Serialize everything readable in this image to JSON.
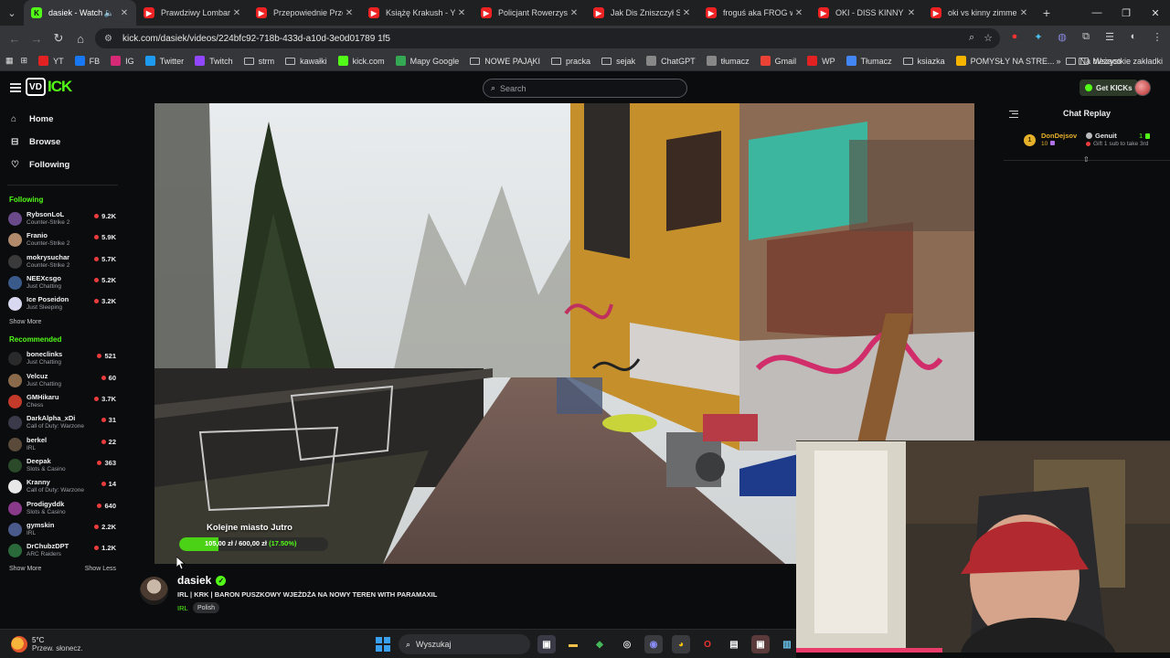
{
  "browser": {
    "tabs": [
      {
        "label": "dasiek - Watch th",
        "icon": "kick",
        "active": true,
        "audio": true
      },
      {
        "label": "Prawdziwy Lombard",
        "icon": "youtube"
      },
      {
        "label": "Przepowiednie Przes",
        "icon": "youtube"
      },
      {
        "label": "Książę Krakush - You",
        "icon": "youtube"
      },
      {
        "label": "Policjant Rowerzysta",
        "icon": "youtube"
      },
      {
        "label": "Jak Dis Zniszczył Swo",
        "icon": "youtube"
      },
      {
        "label": "froguś aka FROG wb",
        "icon": "youtube"
      },
      {
        "label": "OKI - DISS KINNY ZI",
        "icon": "youtube"
      },
      {
        "label": "oki vs kinny zimmer",
        "icon": "youtube"
      }
    ],
    "url": "kick.com/dasiek/videos/224bfc92-718b-433d-a10d-3e0d01789 1f5",
    "bookmarks": [
      {
        "label": "YT",
        "icon": "youtube",
        "color": "#e22222"
      },
      {
        "label": "FB",
        "icon": "facebook",
        "color": "#1877f2"
      },
      {
        "label": "IG",
        "icon": "instagram",
        "color": "#d62976"
      },
      {
        "label": "Twitter",
        "icon": "twitter",
        "color": "#1d9bf0"
      },
      {
        "label": "Twitch",
        "icon": "twitch",
        "color": "#9146ff"
      },
      {
        "label": "strm",
        "icon": "folder"
      },
      {
        "label": "kawałki",
        "icon": "folder"
      },
      {
        "label": "kick.com",
        "icon": "kick",
        "color": "#53fc18"
      },
      {
        "label": "Mapy Google",
        "icon": "maps",
        "color": "#34a853"
      },
      {
        "label": "NOWE PAJĄKI",
        "icon": "folder"
      },
      {
        "label": "pracka",
        "icon": "folder"
      },
      {
        "label": "sejak",
        "icon": "folder"
      },
      {
        "label": "ChatGPT",
        "icon": "chatgpt",
        "color": "#888888"
      },
      {
        "label": "tłumacz",
        "icon": "deepl",
        "color": "#888888"
      },
      {
        "label": "Gmail",
        "icon": "gmail",
        "color": "#ea4335"
      },
      {
        "label": "WP",
        "icon": "wp",
        "color": "#e22222"
      },
      {
        "label": "Tłumacz",
        "icon": "translate",
        "color": "#4285f4"
      },
      {
        "label": "ksiazka",
        "icon": "folder"
      },
      {
        "label": "POMYSŁY NA STRE...",
        "icon": "docs",
        "color": "#f4b400"
      },
      {
        "label": "Na bieżąco",
        "icon": "folder"
      }
    ],
    "bookmarks_overflow": "»",
    "bookmarks_all": "Wszystkie zakładki"
  },
  "kick": {
    "logo_badge": "VD",
    "logo_word": "ICK",
    "search_placeholder": "Search",
    "get_kicks": "Get KICKs",
    "nav": [
      {
        "label": "Home",
        "icon": "home"
      },
      {
        "label": "Browse",
        "icon": "browse"
      },
      {
        "label": "Following",
        "icon": "heart"
      }
    ],
    "following_header": "Following",
    "following": [
      {
        "name": "RybsonLoL",
        "category": "Counter-Strike 2",
        "viewers": "9.2K",
        "color": "#6a4a8a"
      },
      {
        "name": "Franio",
        "category": "Counter-Strike 2",
        "viewers": "5.9K",
        "color": "#b08a6a"
      },
      {
        "name": "mokrysuchar",
        "category": "Counter-Strike 2",
        "viewers": "5.7K",
        "color": "#3a3a3a"
      },
      {
        "name": "NEEXcsgo",
        "category": "Just Chatting",
        "viewers": "5.2K",
        "color": "#3a5a8a"
      },
      {
        "name": "Ice Poseidon",
        "category": "Just Sleeping",
        "viewers": "3.2K",
        "color": "#d8d8f0"
      }
    ],
    "show_more_1": "Show More",
    "recommended_header": "Recommended",
    "recommended": [
      {
        "name": "boneclinks",
        "category": "Just Chatting",
        "viewers": "521",
        "color": "#2a2a2a"
      },
      {
        "name": "Velcuz",
        "category": "Just Chatting",
        "viewers": "60",
        "color": "#8a6a4a"
      },
      {
        "name": "GMHikaru",
        "category": "Chess",
        "viewers": "3.7K",
        "color": "#c43a2a"
      },
      {
        "name": "DarkAlpha_xDi",
        "category": "Call of Duty: Warzone",
        "viewers": "31",
        "color": "#3a3a4a"
      },
      {
        "name": "berkel",
        "category": "IRL",
        "viewers": "22",
        "color": "#5a4a3a"
      },
      {
        "name": "Deepak",
        "category": "Slots & Casino",
        "viewers": "363",
        "color": "#2a4a2a"
      },
      {
        "name": "Kranny",
        "category": "Call of Duty: Warzone",
        "viewers": "14",
        "color": "#e8e8e8"
      },
      {
        "name": "Prodigyddk",
        "category": "Slots & Casino",
        "viewers": "640",
        "color": "#8a3a8a"
      },
      {
        "name": "gymskin",
        "category": "IRL",
        "viewers": "2.2K",
        "color": "#4a5a8a"
      },
      {
        "name": "DrChubzDPT",
        "category": "ARC Raiders",
        "viewers": "1.2K",
        "color": "#2a6a3a"
      }
    ],
    "show_more_2": "Show More",
    "show_less": "Show Less"
  },
  "goal": {
    "title": "Kolejne miasto Jutro",
    "current": "105,00 zł",
    "target": "600,00 zł",
    "percent_label": "(17.50%)",
    "fraction": 0.175
  },
  "stream": {
    "channel": "dasiek",
    "title": "IRL | KRK | BARON PUSZKOWY WJEŻDŻA NA NOWY TEREN WITH PARAMAXIL",
    "category": "IRL",
    "tag": "Polish"
  },
  "chat": {
    "title": "Chat Replay",
    "message": {
      "sub_badge": "1",
      "user": "DonDejsov",
      "user_months": "10",
      "gifter": "Genuit",
      "gift_count": "1",
      "gift_text": "Gift 1 sub to take 3rd"
    }
  },
  "taskbar": {
    "temp": "5°C",
    "weather": "Przew. słonecz.",
    "search": "Wyszukaj"
  },
  "colors": {
    "kick_green": "#53fc18",
    "live_red": "#ea3c3c"
  }
}
